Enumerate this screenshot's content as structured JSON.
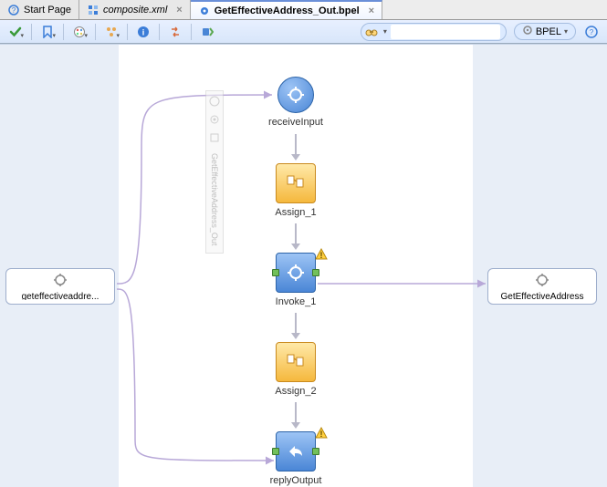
{
  "tabs": {
    "start": "Start Page",
    "composite": "composite.xml",
    "bpelfile": "GetEffectiveAddress_Out.bpel"
  },
  "toolbar": {
    "search_placeholder": "",
    "bpel_label": "BPEL"
  },
  "partners": {
    "left": "geteffectiveaddre...",
    "right": "GetEffectiveAddress"
  },
  "vtoolbar_caption": "GetEffectiveAddress_Out",
  "chart_data": {
    "type": "flow",
    "nodes": [
      {
        "id": "receiveInput",
        "kind": "receive",
        "label": "receiveInput"
      },
      {
        "id": "Assign_1",
        "kind": "assign",
        "label": "Assign_1"
      },
      {
        "id": "Invoke_1",
        "kind": "invoke",
        "label": "Invoke_1",
        "warning": true
      },
      {
        "id": "Assign_2",
        "kind": "assign",
        "label": "Assign_2"
      },
      {
        "id": "replyOutput",
        "kind": "reply",
        "label": "replyOutput",
        "warning": true
      }
    ],
    "edges": [
      {
        "from": "receiveInput",
        "to": "Assign_1"
      },
      {
        "from": "Assign_1",
        "to": "Invoke_1"
      },
      {
        "from": "Invoke_1",
        "to": "Assign_2"
      },
      {
        "from": "Assign_2",
        "to": "replyOutput"
      }
    ],
    "partner_links": [
      {
        "from": "partner_left",
        "to": "receiveInput"
      },
      {
        "from": "Invoke_1",
        "to": "partner_right"
      },
      {
        "from": "partner_left",
        "to": "replyOutput"
      }
    ]
  }
}
